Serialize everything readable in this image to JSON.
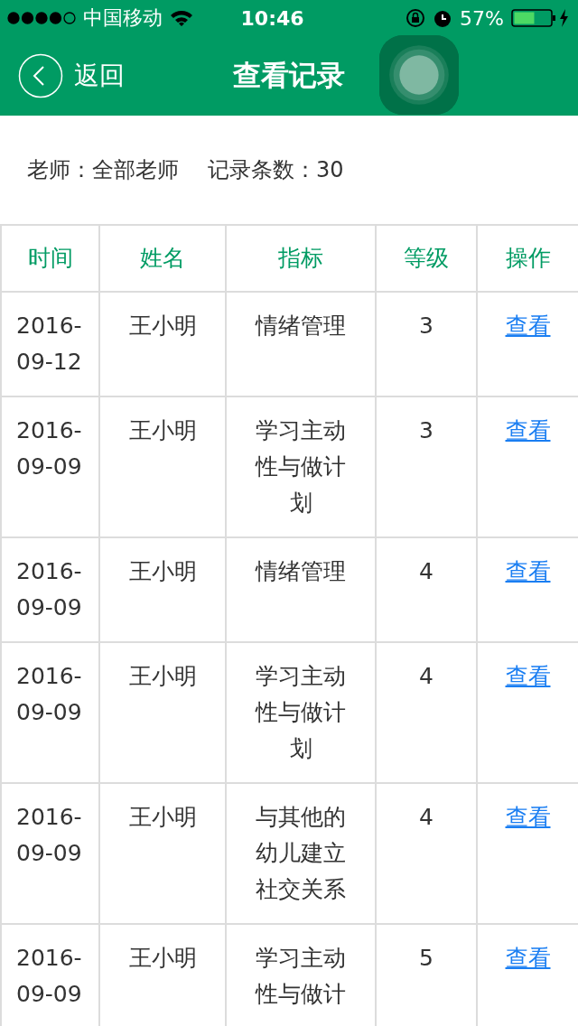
{
  "status_bar": {
    "carrier": "中国移动",
    "time": "10:46",
    "battery": "57%"
  },
  "nav": {
    "back": "返回",
    "title": "查看记录"
  },
  "summary": {
    "teacher": "老师：全部老师",
    "count": "记录条数：30"
  },
  "table": {
    "columns": [
      "时间",
      "姓名",
      "指标",
      "等级",
      "操作"
    ],
    "rows": [
      {
        "date": "2016-09-12",
        "name": "王小明",
        "indicator": "情绪管理",
        "level": "3",
        "action": "查看"
      },
      {
        "date": "2016-09-09",
        "name": "王小明",
        "indicator": "学习主动性与做计划",
        "level": "3",
        "action": "查看"
      },
      {
        "date": "2016-09-09",
        "name": "王小明",
        "indicator": "情绪管理",
        "level": "4",
        "action": "查看"
      },
      {
        "date": "2016-09-09",
        "name": "王小明",
        "indicator": "学习主动性与做计划",
        "level": "4",
        "action": "查看"
      },
      {
        "date": "2016-09-09",
        "name": "王小明",
        "indicator": "与其他的幼儿建立社交关系",
        "level": "4",
        "action": "查看"
      },
      {
        "date": "2016-09-09",
        "name": "王小明",
        "indicator": "学习主动性与做计",
        "level": "5",
        "action": "查看"
      }
    ]
  }
}
